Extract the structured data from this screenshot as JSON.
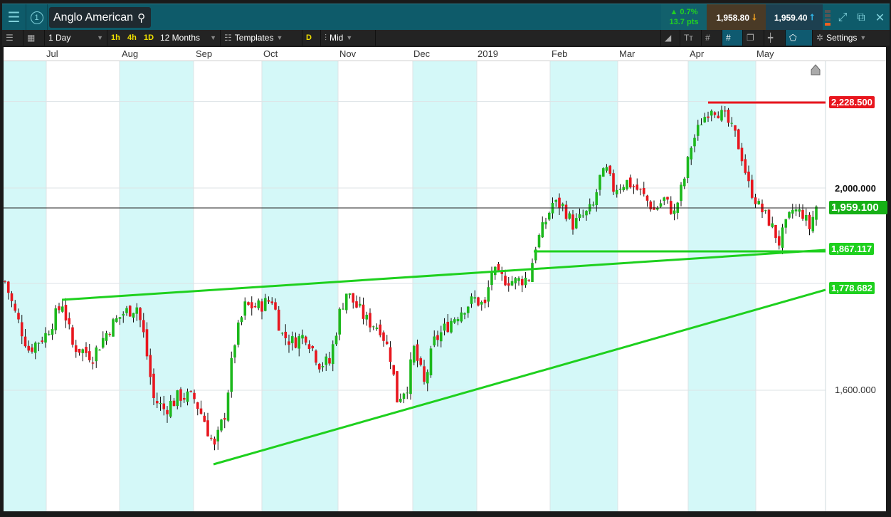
{
  "header": {
    "instrument": "Anglo American",
    "workspace_number": "1",
    "change_pct": "▲ 0.7%",
    "change_pts": "13.7 pts",
    "sell_price": "1,958.80",
    "buy_price": "1,959.40"
  },
  "toolbar": {
    "interval": "1 Day",
    "quick_intervals": [
      "1h",
      "4h",
      "1D"
    ],
    "range": "12 Months",
    "templates": "Templates",
    "d_label": "D",
    "price_type": "Mid",
    "settings": "Settings"
  },
  "colors": {
    "up": "#1cb81c",
    "down": "#e8161e",
    "band": "#d4f8f8",
    "trend": "#1ed01e",
    "resistance": "#e8161e"
  },
  "chart_data": {
    "type": "candlestick",
    "x_labels": [
      "Jul",
      "Aug",
      "Sep",
      "Oct",
      "Nov",
      "Dec",
      "2019",
      "Feb",
      "Mar",
      "Apr",
      "May"
    ],
    "y_ticks": [
      "2,000.000",
      "1,600.000"
    ],
    "y_scale": "log",
    "ylim": [
      1430,
      2330
    ],
    "last_price": "1,959.100",
    "levels": {
      "resistance": "2,228.500",
      "support": "1,867.117",
      "trend_low": "1,778.682"
    },
    "close_trace": [
      [
        0,
        1804
      ],
      [
        3,
        1742
      ],
      [
        7,
        1674
      ],
      [
        12,
        1701
      ],
      [
        17,
        1762
      ],
      [
        20,
        1681
      ],
      [
        26,
        1662
      ],
      [
        31,
        1715
      ],
      [
        35,
        1742
      ],
      [
        39,
        1755
      ],
      [
        41,
        1701
      ],
      [
        44,
        1585
      ],
      [
        47,
        1567
      ],
      [
        52,
        1591
      ],
      [
        56,
        1585
      ],
      [
        59,
        1548
      ],
      [
        62,
        1500
      ],
      [
        65,
        1560
      ],
      [
        68,
        1688
      ],
      [
        71,
        1755
      ],
      [
        75,
        1755
      ],
      [
        79,
        1769
      ],
      [
        82,
        1701
      ],
      [
        85,
        1688
      ],
      [
        89,
        1701
      ],
      [
        93,
        1649
      ],
      [
        96,
        1649
      ],
      [
        99,
        1742
      ],
      [
        101,
        1783
      ],
      [
        104,
        1755
      ],
      [
        107,
        1728
      ],
      [
        111,
        1715
      ],
      [
        114,
        1662
      ],
      [
        116,
        1585
      ],
      [
        119,
        1610
      ],
      [
        121,
        1674
      ],
      [
        124,
        1610
      ],
      [
        127,
        1688
      ],
      [
        132,
        1728
      ],
      [
        136,
        1755
      ],
      [
        139,
        1769
      ],
      [
        142,
        1755
      ],
      [
        144,
        1826
      ],
      [
        146,
        1812
      ],
      [
        151,
        1804
      ],
      [
        155,
        1812
      ],
      [
        157,
        1877
      ],
      [
        160,
        1929
      ],
      [
        162,
        1967
      ],
      [
        165,
        1960
      ],
      [
        168,
        1921
      ],
      [
        172,
        1944
      ],
      [
        174,
        1960
      ],
      [
        176,
        2022
      ],
      [
        178,
        2038
      ],
      [
        180,
        1998
      ],
      [
        184,
        2014
      ],
      [
        188,
        1991
      ],
      [
        192,
        1952
      ],
      [
        195,
        1975
      ],
      [
        198,
        1944
      ],
      [
        201,
        2022
      ],
      [
        203,
        2095
      ],
      [
        206,
        2153
      ],
      [
        209,
        2187
      ],
      [
        213,
        2162
      ],
      [
        216,
        2120
      ],
      [
        218,
        2070
      ],
      [
        220,
        2006
      ],
      [
        223,
        1960
      ],
      [
        226,
        1929
      ],
      [
        229,
        1884
      ],
      [
        233,
        1952
      ],
      [
        236,
        1944
      ],
      [
        238,
        1914
      ],
      [
        240,
        1960
      ]
    ]
  }
}
